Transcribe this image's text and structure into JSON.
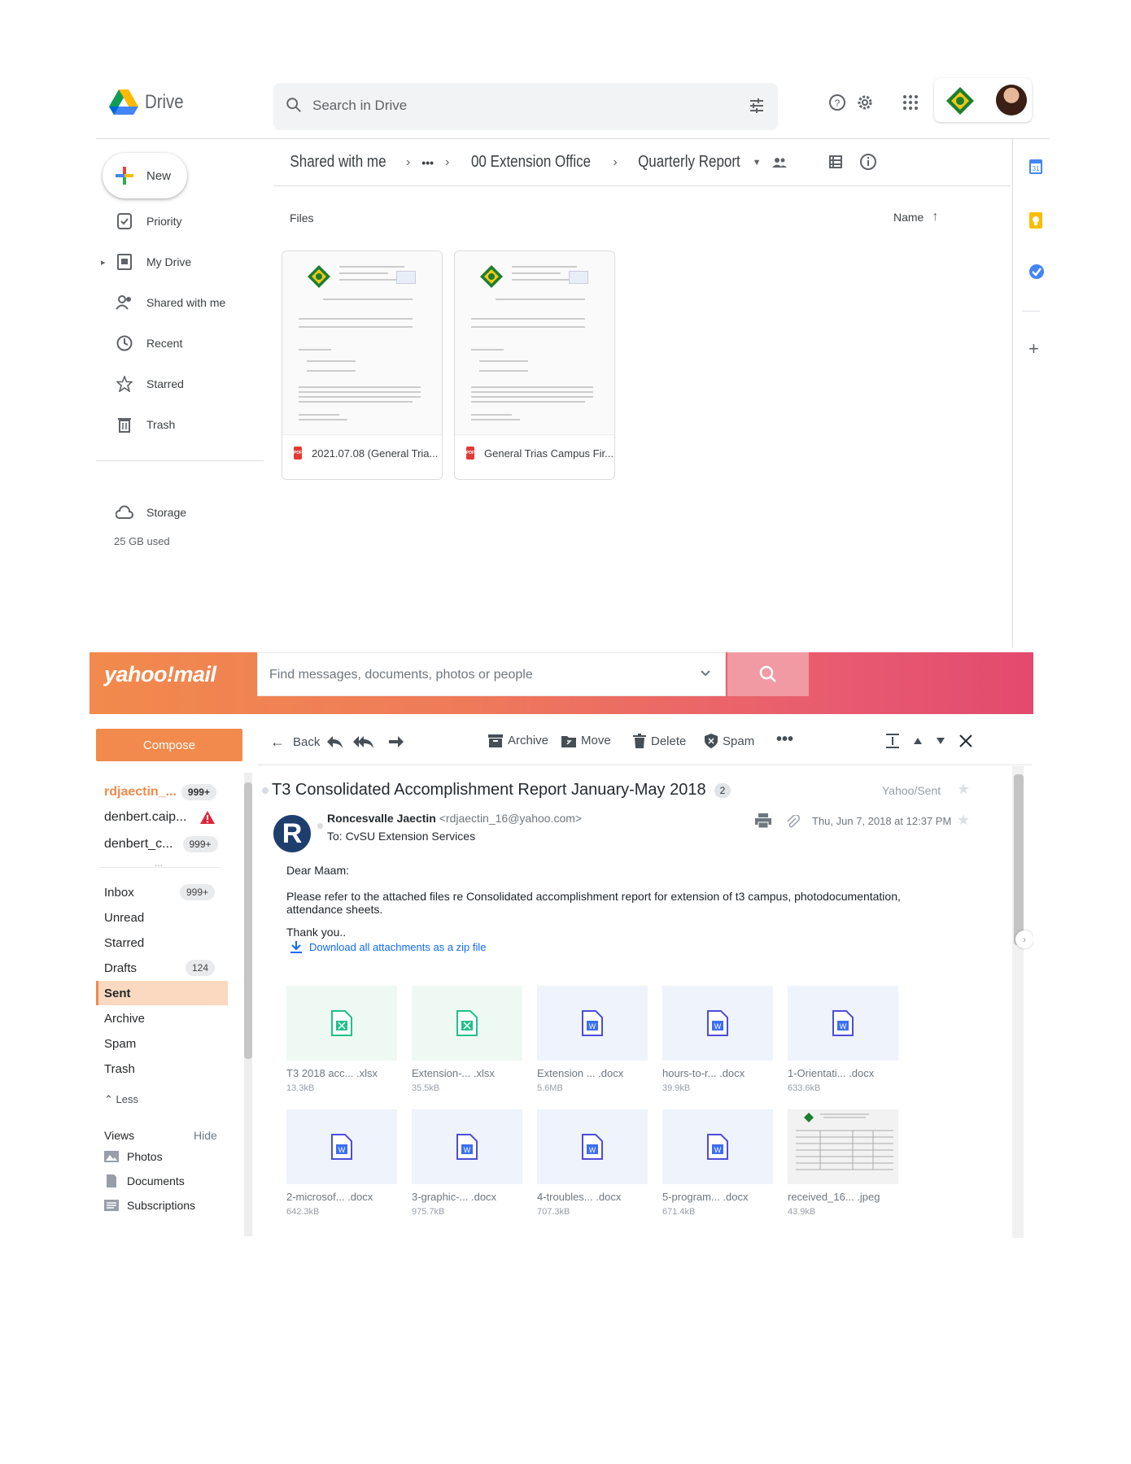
{
  "drive": {
    "app_name": "Drive",
    "search_placeholder": "Search in Drive",
    "new_label": "New",
    "nav": [
      {
        "label": "Priority",
        "icon": "priority-icon"
      },
      {
        "label": "My Drive",
        "icon": "my-drive-icon"
      },
      {
        "label": "Shared with me",
        "icon": "shared-icon"
      },
      {
        "label": "Recent",
        "icon": "clock-icon"
      },
      {
        "label": "Starred",
        "icon": "star-icon"
      },
      {
        "label": "Trash",
        "icon": "trash-icon"
      }
    ],
    "storage_label": "Storage",
    "storage_used": "25 GB used",
    "breadcrumb": [
      "Shared with me",
      "•••",
      "00 Extension Office",
      "Quarterly Report"
    ],
    "files_label": "Files",
    "sort_label": "Name",
    "files": [
      {
        "name": "2021.07.08 (General Tria...",
        "type": "PDF"
      },
      {
        "name": "General Trias Campus Fir...",
        "type": "PDF"
      }
    ]
  },
  "yahoo": {
    "logo": "yahoo!mail",
    "search_placeholder": "Find messages, documents, photos or people",
    "compose": "Compose",
    "accounts": [
      {
        "name": "rdjaectin_...",
        "badge": "999+",
        "active": true
      },
      {
        "name": "denbert.caip...",
        "badge": "!"
      },
      {
        "name": "denbert_c...",
        "badge": "999+"
      }
    ],
    "more": "...",
    "folders": [
      {
        "name": "Inbox",
        "badge": "999+"
      },
      {
        "name": "Unread",
        "badge": ""
      },
      {
        "name": "Starred",
        "badge": ""
      },
      {
        "name": "Drafts",
        "badge": "124"
      },
      {
        "name": "Sent",
        "badge": "",
        "selected": true
      },
      {
        "name": "Archive",
        "badge": ""
      },
      {
        "name": "Spam",
        "badge": ""
      },
      {
        "name": "Trash",
        "badge": ""
      }
    ],
    "less": "Less",
    "views_label": "Views",
    "hide_label": "Hide",
    "views": [
      "Photos",
      "Documents",
      "Subscriptions"
    ],
    "toolbar": {
      "back": "Back",
      "archive": "Archive",
      "move": "Move",
      "delete": "Delete",
      "spam": "Spam"
    },
    "subject": "T3 Consolidated Accomplishment Report January-May 2018",
    "thread_count": "2",
    "folder_tag": "Yahoo/Sent",
    "sender_name": "Roncesvalle Jaectin",
    "sender_email": "<rdjaectin_16@yahoo.com>",
    "to": "To: CvSU Extension Services",
    "date": "Thu, Jun 7, 2018 at 12:37 PM",
    "avatar_letter": "R",
    "greeting": "Dear Maam:",
    "body": "Please refer to the attached files re Consolidated accomplishment report for extension of t3 campus, photodocumentation, attendance sheets.",
    "thanks": "Thank you..",
    "download_all": "Download all attachments as a zip file",
    "attachments": [
      {
        "name": "T3 2018 acc... .xlsx",
        "size": "13.3kB",
        "kind": "xlsx"
      },
      {
        "name": "Extension-... .xlsx",
        "size": "35.5kB",
        "kind": "xlsx"
      },
      {
        "name": "Extension ... .docx",
        "size": "5.6MB",
        "kind": "docx"
      },
      {
        "name": "hours-to-r... .docx",
        "size": "39.9kB",
        "kind": "docx"
      },
      {
        "name": "1-Orientati... .docx",
        "size": "633.6kB",
        "kind": "docx"
      },
      {
        "name": "2-microsof... .docx",
        "size": "642.3kB",
        "kind": "docx"
      },
      {
        "name": "3-graphic-... .docx",
        "size": "975.7kB",
        "kind": "docx"
      },
      {
        "name": "4-troubles... .docx",
        "size": "707.3kB",
        "kind": "docx"
      },
      {
        "name": "5-program... .docx",
        "size": "671.4kB",
        "kind": "docx"
      },
      {
        "name": "received_16... .jpeg",
        "size": "43.9kB",
        "kind": "jpeg"
      }
    ]
  }
}
